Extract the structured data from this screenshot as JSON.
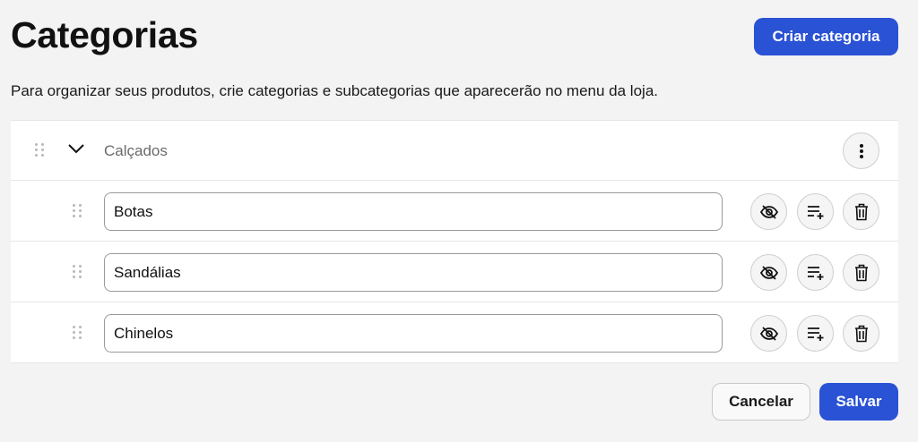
{
  "header": {
    "title": "Categorias",
    "create_label": "Criar categoria",
    "description": "Para organizar seus produtos, crie categorias e subcategorias que aparecerão no menu da loja."
  },
  "category": {
    "name": "Calçados",
    "expanded": true,
    "subcategories": [
      {
        "name": "Botas"
      },
      {
        "name": "Sandálias"
      },
      {
        "name": "Chinelos"
      }
    ]
  },
  "icons": {
    "drag": "drag-handle-icon",
    "expand": "chevron-down-icon",
    "more": "more-vertical-icon",
    "hide": "eye-off-icon",
    "add_subcategory": "list-add-icon",
    "delete": "trash-icon"
  },
  "footer": {
    "cancel_label": "Cancelar",
    "save_label": "Salvar"
  },
  "colors": {
    "primary": "#2a52d4",
    "background": "#f3f3f3",
    "surface": "#ffffff"
  }
}
